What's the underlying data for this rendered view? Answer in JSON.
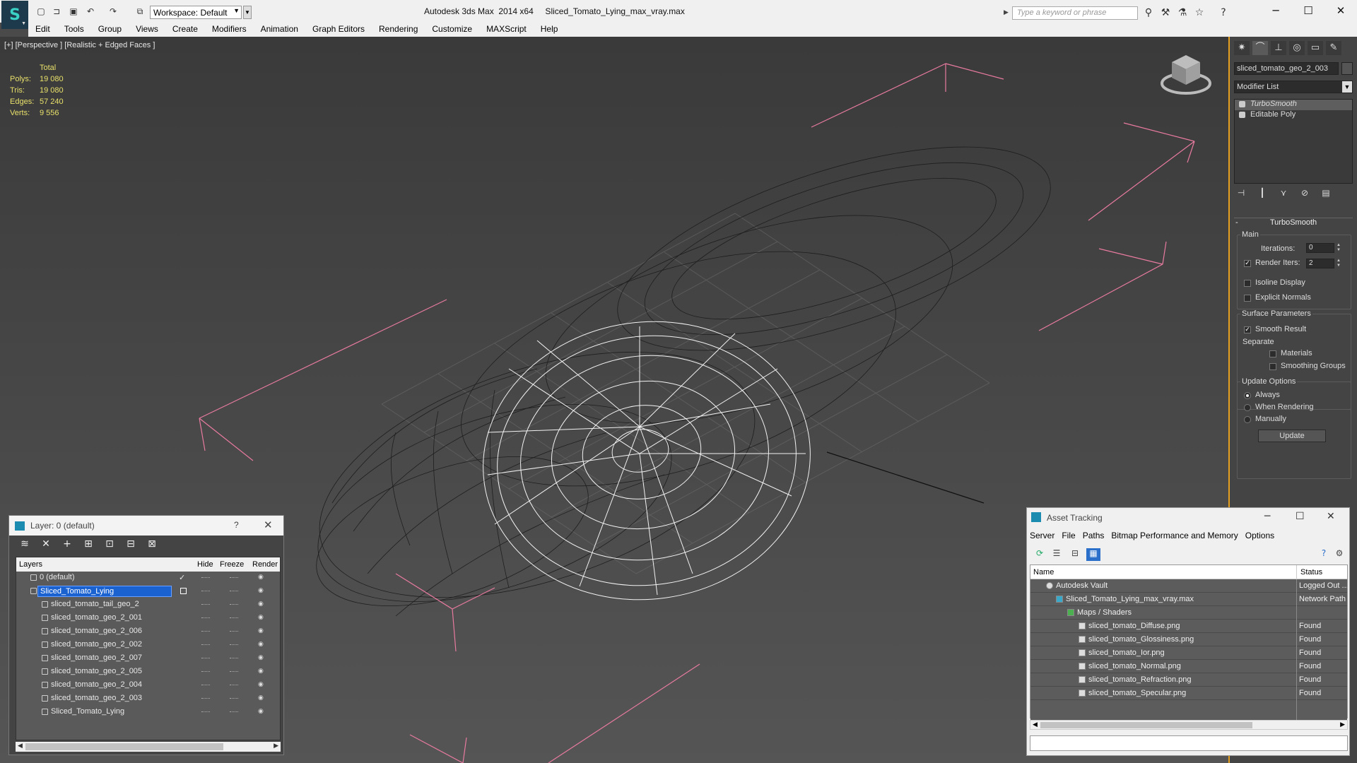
{
  "titlebar": {
    "workspace": "Workspace: Default",
    "title": "Autodesk 3ds Max  2014 x64     Sliced_Tomato_Lying_max_vray.max",
    "search_placeholder": "Type a keyword or phrase"
  },
  "menu": [
    "Edit",
    "Tools",
    "Group",
    "Views",
    "Create",
    "Modifiers",
    "Animation",
    "Graph Editors",
    "Rendering",
    "Customize",
    "MAXScript",
    "Help"
  ],
  "viewport": {
    "label": "[+] [Perspective ] [Realistic + Edged Faces ]",
    "stats": {
      "header": "Total",
      "rows": [
        {
          "k": "Polys:",
          "v": "19 080"
        },
        {
          "k": "Tris:",
          "v": "19 080"
        },
        {
          "k": "Edges:",
          "v": "57 240"
        },
        {
          "k": "Verts:",
          "v": "9 556"
        }
      ]
    }
  },
  "command_panel": {
    "object_name": "sliced_tomato_geo_2_003",
    "modifier_list": "Modifier List",
    "stack": [
      "TurboSmooth",
      "Editable Poly"
    ],
    "rollout": "TurboSmooth",
    "main_group": "Main",
    "iterations_label": "Iterations:",
    "iterations": "0",
    "render_iters_label": "Render Iters:",
    "render_iters": "2",
    "isoline": "Isoline Display",
    "explicit": "Explicit Normals",
    "surface_group": "Surface Parameters",
    "smooth_result": "Smooth Result",
    "separate": "Separate",
    "materials": "Materials",
    "smoothing_groups": "Smoothing Groups",
    "update_group": "Update Options",
    "always": "Always",
    "when_rendering": "When Rendering",
    "manually": "Manually",
    "update_btn": "Update"
  },
  "layer_explorer": {
    "title": "Layer: 0 (default)",
    "help": "?",
    "columns": {
      "layers": "Layers",
      "hide": "Hide",
      "freeze": "Freeze",
      "render": "Render"
    },
    "rows": [
      {
        "name": "0 (default)",
        "indent": 0
      },
      {
        "name": "Sliced_Tomato_Lying",
        "indent": 0
      },
      {
        "name": "sliced_tomato_tail_geo_2",
        "indent": 1
      },
      {
        "name": "sliced_tomato_geo_2_001",
        "indent": 1
      },
      {
        "name": "sliced_tomato_geo_2_006",
        "indent": 1
      },
      {
        "name": "sliced_tomato_geo_2_002",
        "indent": 1
      },
      {
        "name": "sliced_tomato_geo_2_007",
        "indent": 1
      },
      {
        "name": "sliced_tomato_geo_2_005",
        "indent": 1
      },
      {
        "name": "sliced_tomato_geo_2_004",
        "indent": 1
      },
      {
        "name": "sliced_tomato_geo_2_003",
        "indent": 1
      },
      {
        "name": "Sliced_Tomato_Lying",
        "indent": 1
      }
    ]
  },
  "asset_tracking": {
    "title": "Asset Tracking",
    "menu": [
      "Server",
      "File",
      "Paths",
      "Bitmap Performance and Memory",
      "Options"
    ],
    "columns": {
      "name": "Name",
      "status": "Status"
    },
    "rows": [
      {
        "name": "Autodesk Vault",
        "status": "Logged Out ..."
      },
      {
        "name": "Sliced_Tomato_Lying_max_vray.max",
        "status": "Network Path"
      },
      {
        "name": "Maps / Shaders",
        "status": ""
      },
      {
        "name": "sliced_tomato_Diffuse.png",
        "status": "Found"
      },
      {
        "name": "sliced_tomato_Glossiness.png",
        "status": "Found"
      },
      {
        "name": "sliced_tomato_Ior.png",
        "status": "Found"
      },
      {
        "name": "sliced_tomato_Normal.png",
        "status": "Found"
      },
      {
        "name": "sliced_tomato_Refraction.png",
        "status": "Found"
      },
      {
        "name": "sliced_tomato_Specular.png",
        "status": "Found"
      }
    ]
  },
  "colors": {
    "accent_border": "#e6a020",
    "stats_text": "#e8e06a",
    "selection_bracket": "#e87aa0",
    "layer_selected": "#1b62d1"
  }
}
